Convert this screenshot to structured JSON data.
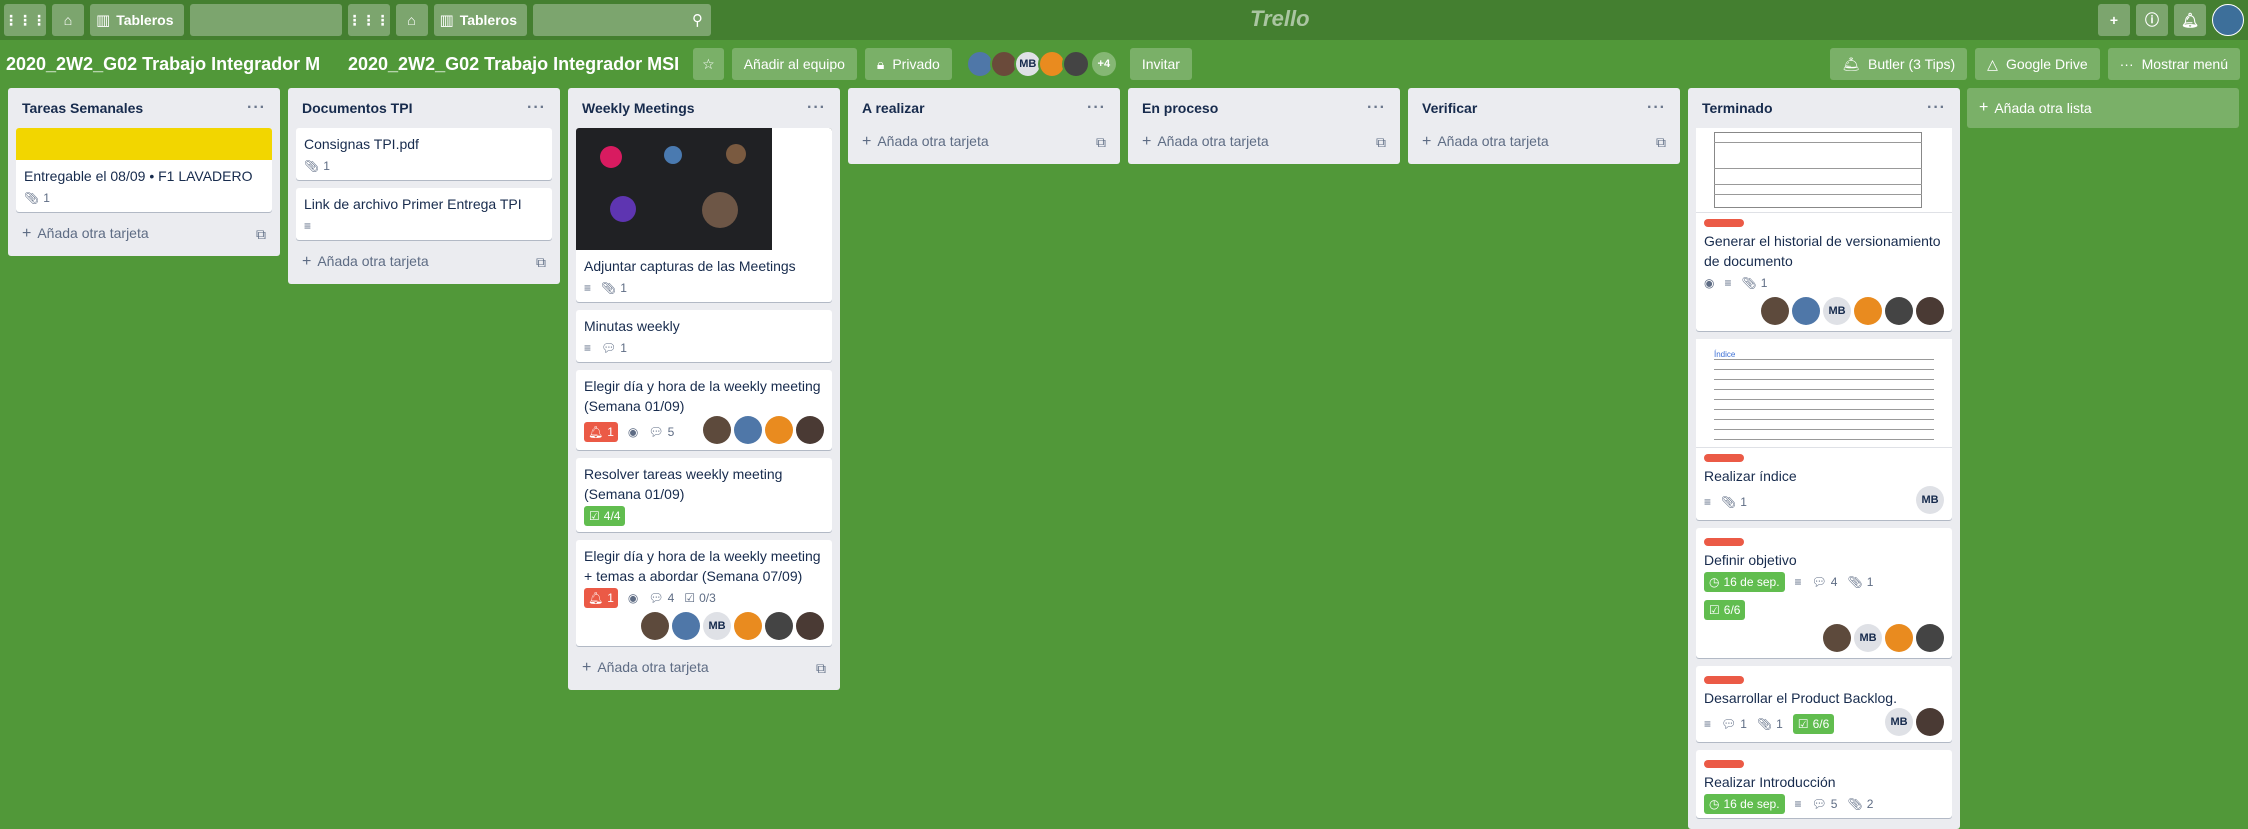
{
  "topbar": {
    "boards_label_1": "Tableros",
    "boards_label_2": "Tableros",
    "logo": "Trello"
  },
  "board": {
    "title_truncated": "2020_2W2_G02 Trabajo Integrador M",
    "title": "2020_2W2_G02 Trabajo Integrador MSI",
    "add_team": "Añadir al equipo",
    "visibility": "Privado",
    "members_more": "+4",
    "member_initials": "MB",
    "invite": "Invitar",
    "butler": "Butler (3 Tips)",
    "google_drive": "Google Drive",
    "show_menu": "Mostrar menú"
  },
  "colors": {
    "background": "#519839",
    "header": "#447f30",
    "label_red": "#eb5a46",
    "label_yellow": "#f2d600",
    "badge_green": "#61bd4f"
  },
  "add_card": "Añada otra tarjeta",
  "add_list": "Añada otra lista",
  "lists": [
    {
      "title": "Tareas Semanales",
      "cards": [
        {
          "title": "Entregable el 08/09 • F1 LAVADERO",
          "attachments": "1"
        }
      ]
    },
    {
      "title": "Documentos TPI",
      "cards": [
        {
          "title": "Consignas TPI.pdf",
          "attachments": "1"
        },
        {
          "title": "Link de archivo Primer Entrega TPI"
        }
      ]
    },
    {
      "title": "Weekly Meetings",
      "cards": [
        {
          "title": "Adjuntar capturas de las Meetings",
          "attachments": "1"
        },
        {
          "title": "Minutas weekly",
          "comments": "1"
        },
        {
          "title": "Elegir día y hora de la weekly meeting (Semana 01/09)",
          "notifications": "1",
          "comments": "5"
        },
        {
          "title": "Resolver tareas weekly meeting (Semana 01/09)",
          "checklist": "4/4"
        },
        {
          "title": "Elegir día y hora de la weekly meeting + temas a abordar (Semana 07/09)",
          "notifications": "1",
          "comments": "4",
          "checklist": "0/3",
          "member_initials": "MB"
        }
      ]
    },
    {
      "title": "A realizar"
    },
    {
      "title": "En proceso"
    },
    {
      "title": "Verificar"
    },
    {
      "title": "Terminado",
      "cards": [
        {
          "title": "Generar el historial de versionamiento de documento",
          "attachments": "1",
          "member_initials": "MB"
        },
        {
          "title": "Realizar índice",
          "attachments": "1",
          "member_initials": "MB"
        },
        {
          "title": "Definir objetivo",
          "due": "16 de sep.",
          "comments": "4",
          "attachments": "1",
          "checklist": "6/6",
          "member_initials": "MB"
        },
        {
          "title": "Desarrollar el Product Backlog.",
          "comments": "1",
          "attachments": "1",
          "checklist": "6/6",
          "member_initials": "MB"
        },
        {
          "title": "Realizar Introducción",
          "due": "16 de sep.",
          "comments": "5",
          "attachments": "2"
        }
      ]
    }
  ],
  "icons": {
    "apps": "apps-icon",
    "home": "home-icon",
    "boards": "boards-icon",
    "search": "search-icon",
    "add": "plus-icon",
    "info": "info-icon",
    "bell": "bell-icon",
    "star": "star-icon",
    "lock": "lock-icon",
    "attachment": "paperclip-icon",
    "description": "description-icon",
    "comment": "comment-icon",
    "watch": "eye-icon",
    "checklist": "checklist-icon",
    "clock": "clock-icon",
    "template": "card-template-icon",
    "more": "more-dots-icon"
  }
}
